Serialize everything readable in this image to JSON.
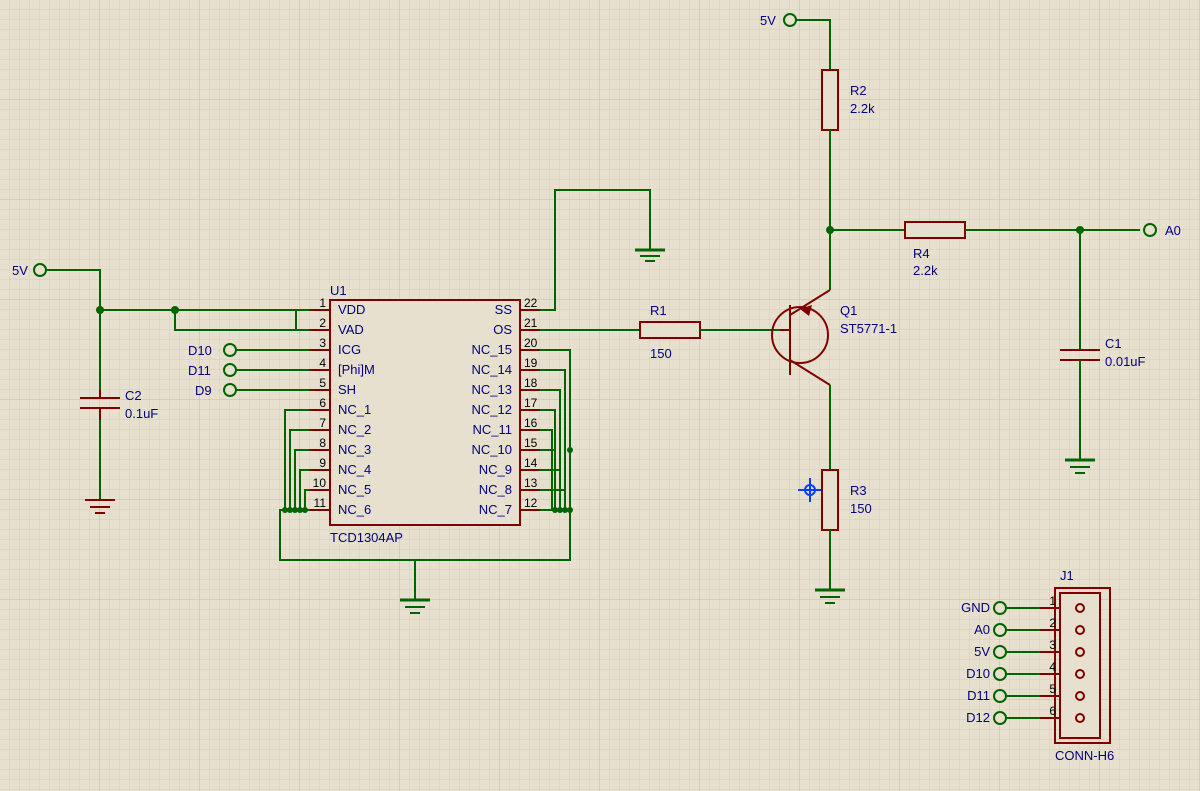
{
  "power": {
    "v5": "5V"
  },
  "outputs": {
    "a0": "A0",
    "d9": "D9",
    "d10": "D10",
    "d11": "D11"
  },
  "U1": {
    "ref": "U1",
    "part": "TCD1304AP",
    "left": [
      {
        "n": "1",
        "name": "VDD"
      },
      {
        "n": "2",
        "name": "VAD"
      },
      {
        "n": "3",
        "name": "ICG"
      },
      {
        "n": "4",
        "name": "[Phi]M"
      },
      {
        "n": "5",
        "name": "SH"
      },
      {
        "n": "6",
        "name": "NC_1"
      },
      {
        "n": "7",
        "name": "NC_2"
      },
      {
        "n": "8",
        "name": "NC_3"
      },
      {
        "n": "9",
        "name": "NC_4"
      },
      {
        "n": "10",
        "name": "NC_5"
      },
      {
        "n": "11",
        "name": "NC_6"
      }
    ],
    "right": [
      {
        "n": "22",
        "name": "SS"
      },
      {
        "n": "21",
        "name": "OS"
      },
      {
        "n": "20",
        "name": "NC_15"
      },
      {
        "n": "19",
        "name": "NC_14"
      },
      {
        "n": "18",
        "name": "NC_13"
      },
      {
        "n": "17",
        "name": "NC_12"
      },
      {
        "n": "16",
        "name": "NC_11"
      },
      {
        "n": "15",
        "name": "NC_10"
      },
      {
        "n": "14",
        "name": "NC_9"
      },
      {
        "n": "13",
        "name": "NC_8"
      },
      {
        "n": "12",
        "name": "NC_7"
      }
    ]
  },
  "C1": {
    "ref": "C1",
    "val": "0.01uF"
  },
  "C2": {
    "ref": "C2",
    "val": "0.1uF"
  },
  "R1": {
    "ref": "R1",
    "val": "150"
  },
  "R2": {
    "ref": "R2",
    "val": "2.2k"
  },
  "R3": {
    "ref": "R3",
    "val": "150"
  },
  "R4": {
    "ref": "R4",
    "val": "2.2k"
  },
  "Q1": {
    "ref": "Q1",
    "val": "ST5771-1"
  },
  "J1": {
    "ref": "J1",
    "part": "CONN-H6",
    "pins": [
      {
        "n": "1",
        "name": "GND"
      },
      {
        "n": "2",
        "name": "A0"
      },
      {
        "n": "3",
        "name": "5V"
      },
      {
        "n": "4",
        "name": "D10"
      },
      {
        "n": "5",
        "name": "D11"
      },
      {
        "n": "6",
        "name": "D12"
      }
    ]
  }
}
